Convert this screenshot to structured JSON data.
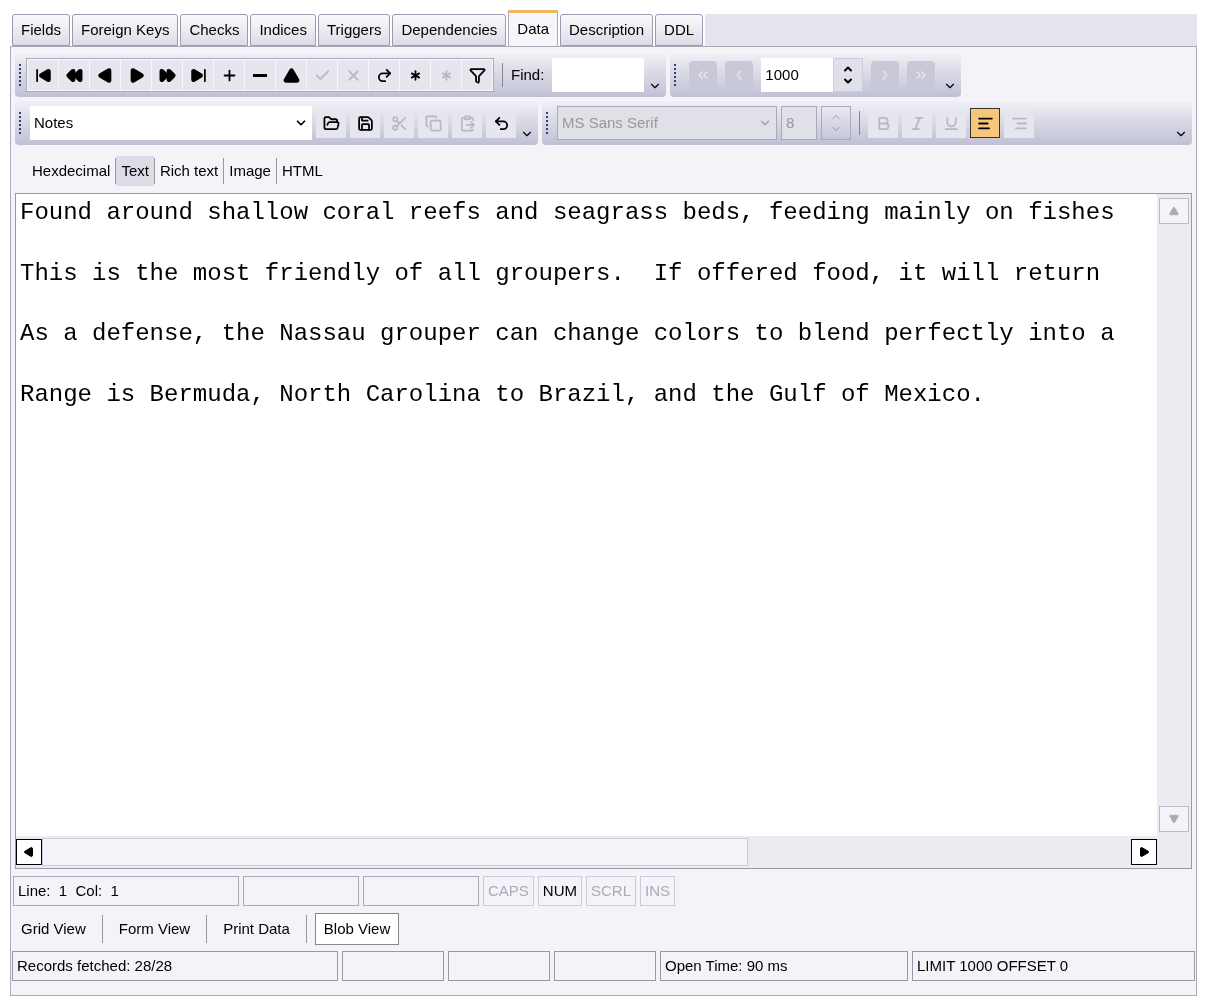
{
  "tabs": [
    {
      "label": "Fields",
      "selected": false
    },
    {
      "label": "Foreign Keys",
      "selected": false
    },
    {
      "label": "Checks",
      "selected": false
    },
    {
      "label": "Indices",
      "selected": false
    },
    {
      "label": "Triggers",
      "selected": false
    },
    {
      "label": "Dependencies",
      "selected": false
    },
    {
      "label": "Data",
      "selected": true
    },
    {
      "label": "Description",
      "selected": false
    },
    {
      "label": "DDL",
      "selected": false
    }
  ],
  "nav_toolbar": {
    "buttons": [
      {
        "kind": "first",
        "disabled": false
      },
      {
        "kind": "prior-page",
        "disabled": false
      },
      {
        "kind": "prior",
        "disabled": false
      },
      {
        "kind": "next",
        "disabled": false
      },
      {
        "kind": "next-page",
        "disabled": false
      },
      {
        "kind": "last",
        "disabled": false
      },
      {
        "kind": "insert",
        "disabled": false
      },
      {
        "kind": "delete",
        "disabled": false
      },
      {
        "kind": "edit",
        "disabled": false
      },
      {
        "kind": "post",
        "disabled": true
      },
      {
        "kind": "cancel",
        "disabled": true
      },
      {
        "kind": "refresh",
        "disabled": false
      },
      {
        "kind": "star",
        "disabled": false
      },
      {
        "kind": "star",
        "disabled": true
      },
      {
        "kind": "filter",
        "disabled": false
      }
    ],
    "find_label": "Find:"
  },
  "page_toolbar": {
    "buttons_before": [
      {
        "kind": "first",
        "disabled": true
      },
      {
        "kind": "prior",
        "disabled": true
      }
    ],
    "limit": "1000",
    "buttons_after": [
      {
        "kind": "next",
        "disabled": true
      },
      {
        "kind": "last",
        "disabled": true
      }
    ]
  },
  "edit_toolbar": {
    "field": "Notes",
    "buttons": [
      {
        "kind": "open",
        "disabled": false
      },
      {
        "kind": "save",
        "disabled": false
      },
      {
        "kind": "cut",
        "disabled": true
      },
      {
        "kind": "copy",
        "disabled": true
      },
      {
        "kind": "paste",
        "disabled": true
      },
      {
        "kind": "undo",
        "disabled": false
      }
    ]
  },
  "format_toolbar": {
    "font": "MS Sans Serif",
    "size": "8",
    "disabled": true,
    "buttons": [
      {
        "kind": "bold",
        "selected": false
      },
      {
        "kind": "italic",
        "selected": false
      },
      {
        "kind": "underline",
        "selected": false
      },
      {
        "kind": "align-left",
        "selected": true
      },
      {
        "kind": "align-right",
        "selected": false
      }
    ]
  },
  "view_tabs": [
    {
      "label": "Hexdecimal",
      "selected": false
    },
    {
      "label": "Text",
      "selected": true
    },
    {
      "label": "Rich text",
      "selected": false
    },
    {
      "label": "Image",
      "selected": false
    },
    {
      "label": "HTML",
      "selected": false
    }
  ],
  "editor_lines": [
    "Found around shallow coral reefs and seagrass beds, feeding mainly on fishes",
    "This is the most friendly of all groupers.  If offered food, it will return",
    "As a defense, the Nassau grouper can change colors to blend perfectly into a",
    "Range is Bermuda, North Carolina to Brazil, and the Gulf of Mexico."
  ],
  "editor_status": {
    "position": "Line:  1  Col:  1",
    "indicators": [
      {
        "label": "CAPS",
        "on": false
      },
      {
        "label": "NUM",
        "on": true
      },
      {
        "label": "SCRL",
        "on": false
      },
      {
        "label": "INS",
        "on": false
      }
    ]
  },
  "bottom_tabs": [
    {
      "label": "Grid View",
      "selected": false
    },
    {
      "label": "Form View",
      "selected": false
    },
    {
      "label": "Print Data",
      "selected": false
    },
    {
      "label": "Blob View",
      "selected": true
    }
  ],
  "status_bar": {
    "records": "Records fetched: 28/28",
    "open_time": "Open Time: 90 ms",
    "query": "LIMIT 1000 OFFSET 0"
  }
}
